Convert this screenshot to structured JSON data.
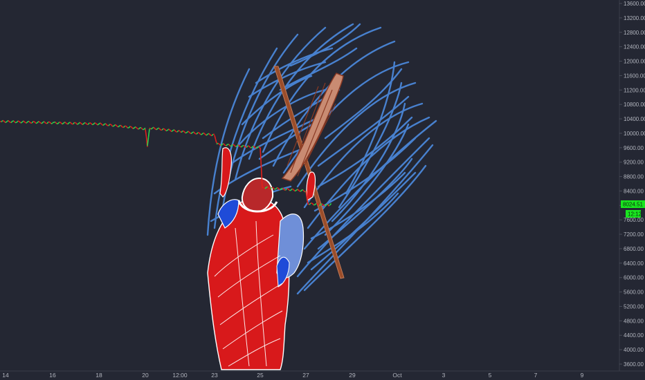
{
  "colors": {
    "background": "#242733",
    "axis_line": "#3a3e4a",
    "up": "#2bd34c",
    "down": "#e0201b",
    "label_green": "#19e51f",
    "drawing_blue": "#4a86d8",
    "robe_red": "#d8191b",
    "staff_brown": "#9b4d2a"
  },
  "price_axis": {
    "ticks": [
      "13600.00",
      "13200.00",
      "12800.00",
      "12400.00",
      "12000.00",
      "11600.00",
      "11200.00",
      "10800.00",
      "10400.00",
      "10000.00",
      "9600.00",
      "9200.00",
      "8800.00",
      "8400.00",
      "8000.00",
      "7600.00",
      "7200.00",
      "6800.00",
      "6400.00",
      "6000.00",
      "5600.00",
      "5200.00",
      "4800.00",
      "4400.00",
      "4000.00",
      "3600.00"
    ],
    "last_price_label": "8024.51",
    "countdown_label": "12:12"
  },
  "time_axis": {
    "ticks": [
      "14",
      "16",
      "18",
      "20",
      "12:00",
      "23",
      "25",
      "27",
      "29",
      "Oct",
      "3",
      "5",
      "7",
      "9"
    ]
  },
  "chart_data": {
    "type": "line",
    "ylim": [
      3600,
      13600
    ],
    "x": [
      "14",
      "16",
      "18",
      "20",
      "12:00",
      "23",
      "25",
      "27",
      "29",
      "Oct",
      "3",
      "5",
      "7",
      "9"
    ],
    "series": [
      {
        "points": [
          [
            "14",
            10330
          ],
          [
            "16",
            10290
          ],
          [
            "18",
            10260
          ],
          [
            "20",
            10120
          ],
          [
            "20",
            9650
          ],
          [
            "20",
            10150
          ],
          [
            "12:00",
            10050
          ],
          [
            "23",
            9950
          ],
          [
            "23",
            9700
          ],
          [
            "25",
            9600
          ],
          [
            "25",
            8500
          ],
          [
            "27",
            8400
          ],
          [
            "27",
            8050
          ],
          [
            "28",
            8000
          ],
          [
            "28",
            8024.51
          ]
        ]
      }
    ]
  }
}
